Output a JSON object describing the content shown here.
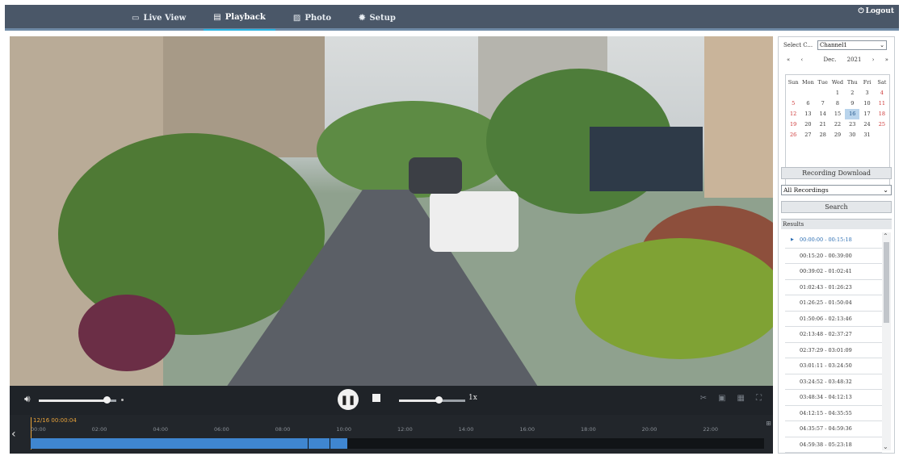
{
  "nav": {
    "items": [
      {
        "label": "Live View",
        "icon": "monitor-icon",
        "active": false
      },
      {
        "label": "Playback",
        "icon": "film-icon",
        "active": true
      },
      {
        "label": "Photo",
        "icon": "image-icon",
        "active": false
      },
      {
        "label": "Setup",
        "icon": "gear-icon",
        "active": false
      }
    ],
    "logout": "Logout"
  },
  "controls": {
    "volume": 0.88,
    "speed_position": 0.6,
    "speed_label": "1x"
  },
  "timeline": {
    "current_time": "12/16 00:00:04",
    "ticks": [
      "00:00",
      "02:00",
      "04:00",
      "06:00",
      "08:00",
      "10:00",
      "12:00",
      "14:00",
      "16:00",
      "18:00",
      "20:00",
      "22:00"
    ],
    "recorded_hours": [
      [
        0,
        9.1
      ],
      [
        9.1,
        9.8
      ],
      [
        9.8,
        10.4
      ]
    ]
  },
  "panel": {
    "channel_label": "Select C...",
    "channel_value": "Channel1",
    "month": "Dec.",
    "year": "2021",
    "weekdays": [
      "Sun",
      "Mon",
      "Tue",
      "Wed",
      "Thu",
      "Fri",
      "Sat"
    ],
    "days": [
      [
        "",
        "",
        "",
        "1",
        "2",
        "3",
        "4"
      ],
      [
        "5",
        "6",
        "7",
        "8",
        "9",
        "10",
        "11"
      ],
      [
        "12",
        "13",
        "14",
        "15",
        "16",
        "17",
        "18"
      ],
      [
        "19",
        "20",
        "21",
        "22",
        "23",
        "24",
        "25"
      ],
      [
        "26",
        "27",
        "28",
        "29",
        "30",
        "31",
        ""
      ]
    ],
    "selected_day": "16",
    "recording_download": "Recording Download",
    "recording_type": "All Recordings",
    "search": "Search",
    "results_label": "Results",
    "results": [
      "00:00:00 - 00:15:18",
      "00:15:20 - 00:39:00",
      "00:39:02 - 01:02:41",
      "01:02:43 - 01:26:23",
      "01:26:25 - 01:50:04",
      "01:50:06 - 02:13:46",
      "02:13:48 - 02:37:27",
      "02:37:29 - 03:01:09",
      "03:01:11 - 03:24:50",
      "03:24:52 - 03:48:32",
      "03:48:34 - 04:12:13",
      "04:12:15 - 04:35:55",
      "04:35:57 - 04:59:36",
      "04:59:38 - 05:23:18"
    ]
  }
}
